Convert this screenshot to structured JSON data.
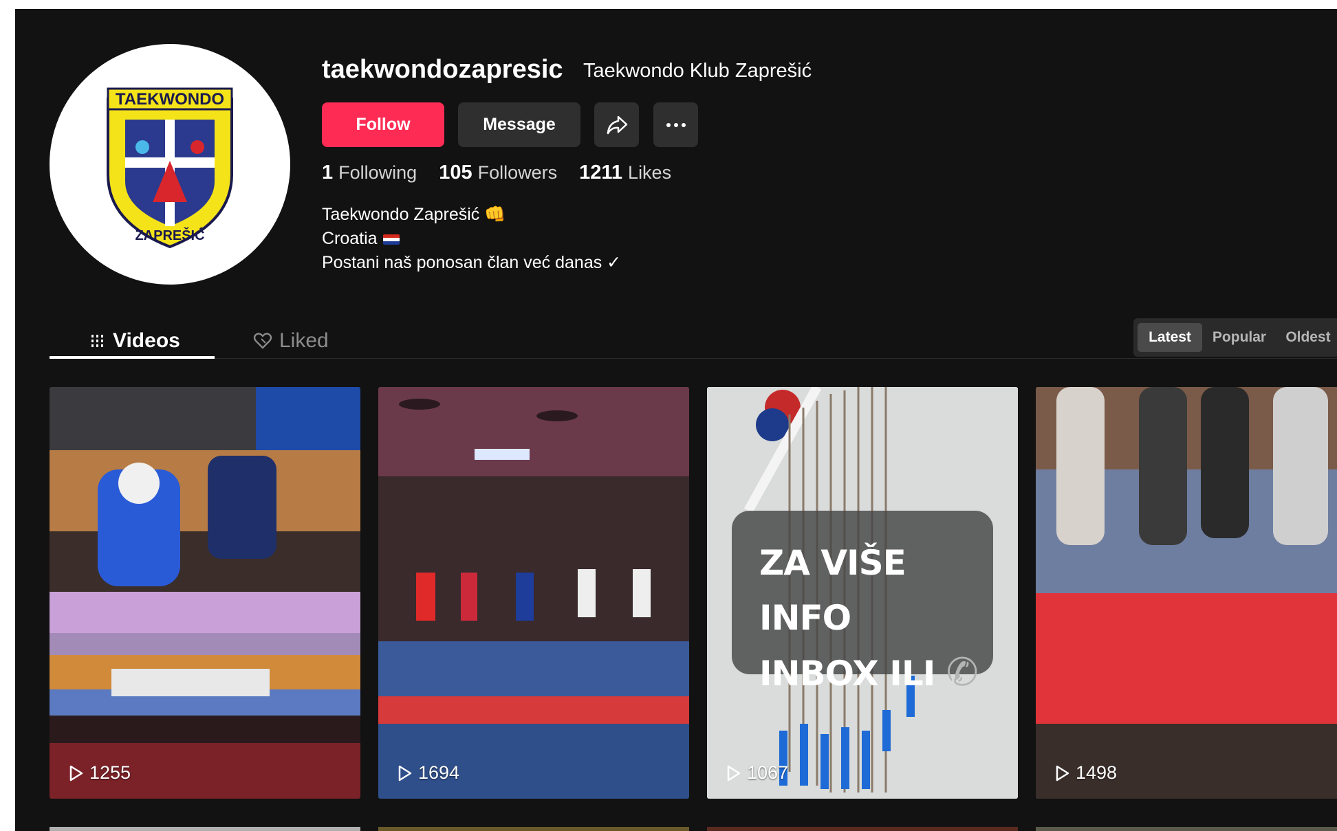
{
  "profile": {
    "username": "taekwondozapresic",
    "nickname": "Taekwondo Klub Zaprešić",
    "logo_text_top": "TAEKWONDO",
    "logo_text_bottom": "ZAPREŠIĆ",
    "buttons": {
      "follow": "Follow",
      "message": "Message"
    },
    "stats": [
      {
        "value": "1",
        "label": "Following"
      },
      {
        "value": "105",
        "label": "Followers"
      },
      {
        "value": "1211",
        "label": "Likes"
      }
    ],
    "bio": [
      "Taekwondo Zaprešić 👊",
      "Croatia",
      "Postani naš ponosan član već danas ✓"
    ]
  },
  "tabs": {
    "videos": "Videos",
    "liked": "Liked"
  },
  "sort": {
    "latest": "Latest",
    "popular": "Popular",
    "oldest": "Oldest"
  },
  "videos": [
    {
      "views": "1255"
    },
    {
      "views": "1694"
    },
    {
      "views": "1067",
      "overlay_line1": "ZA VIŠE INFO",
      "overlay_line2": "INBOX ILI"
    },
    {
      "views": "1498"
    }
  ],
  "colors": {
    "accent": "#fe2c55",
    "background": "#121212"
  }
}
